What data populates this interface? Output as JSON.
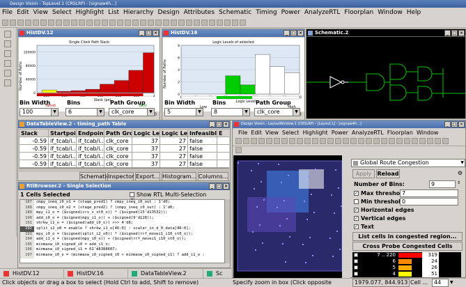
{
  "app": {
    "title": "Design Vision - TopLevel.1 (CRSLRP) - [signaw4h...]"
  },
  "menu": [
    "File",
    "Edit",
    "View",
    "Select",
    "Highlight",
    "List",
    "Hierarchy",
    "Design",
    "Attributes",
    "Schematic",
    "Timing",
    "Power",
    "AnalyzeRTL",
    "Floorplan",
    "Window",
    "Help"
  ],
  "hist1": {
    "title": "HistDV.12",
    "chart_title": "Single Clock Path Slack",
    "ylabel": "Number of Paths",
    "xlabel": "Slack (ps)",
    "worst": "Worst",
    "best": "Best",
    "count": "590",
    "count2": "0",
    "yticks": [
      "120000",
      "80000",
      "40000",
      "0"
    ],
    "xticks": [
      "-600",
      "-500",
      "-400",
      "-300",
      "-200",
      "-100",
      "0"
    ],
    "chart_data": {
      "type": "bar",
      "title": "Single Clock Path Slack",
      "xlabel": "Slack (ps)",
      "ylabel": "Number of Paths",
      "ylim": [
        0,
        140000
      ],
      "bins": [
        {
          "x0": -620,
          "x1": -540,
          "value": 8000,
          "color": "#ffff00"
        },
        {
          "x0": -540,
          "x1": -460,
          "value": 4000,
          "color": "#cc0000"
        },
        {
          "x0": -460,
          "x1": -380,
          "value": 6000,
          "color": "#cc0000"
        },
        {
          "x0": -380,
          "x1": -300,
          "value": 10000,
          "color": "#cc0000"
        },
        {
          "x0": -300,
          "x1": -220,
          "value": 25000,
          "color": "#cc0000"
        },
        {
          "x0": -220,
          "x1": -140,
          "value": 36000,
          "color": "#cc0000"
        },
        {
          "x0": -140,
          "x1": -60,
          "value": 66000,
          "color": "#cc0000"
        },
        {
          "x0": -60,
          "x1": 0,
          "value": 118000,
          "color": "#cc0000"
        }
      ]
    }
  },
  "hist2": {
    "title": "HistDV.16",
    "chart_title": "Logic Levels of selected",
    "ylabel": "Number of Paths",
    "xlabel": "Logic Levels",
    "low": "Low",
    "high": "High",
    "count": "0",
    "count2": "3",
    "yticks": [
      "8",
      "6",
      "4",
      "2",
      "0"
    ],
    "xticks": [
      "0",
      "5",
      "10",
      "15",
      "20",
      "25",
      "30",
      "35",
      "40"
    ],
    "chart_data": {
      "type": "bar",
      "title": "Logic Levels of selected",
      "xlabel": "Logic Levels",
      "ylabel": "Number of Paths",
      "ylim": [
        0,
        8
      ],
      "bins": [
        {
          "x0": 15,
          "x1": 20,
          "value": 3,
          "color": "#00cc00"
        },
        {
          "x0": 20,
          "x1": 25,
          "value": 1.5,
          "color": "#00cc00"
        },
        {
          "x0": 25,
          "x1": 30,
          "value": 6.5,
          "color": "#ffffff"
        },
        {
          "x0": 30,
          "x1": 35,
          "value": 4.5,
          "color": "#ffffff"
        },
        {
          "x0": 35,
          "x1": 40,
          "value": 3.5,
          "color": "#ffffff"
        }
      ]
    }
  },
  "controls1": {
    "bin_width_label": "Bin Width",
    "bins_label": "Bins",
    "path_group_label": "Path Group",
    "bin_width": "100",
    "bins": "6",
    "path_group": "clk_core"
  },
  "controls2": {
    "bin_width_label": "Bin Width",
    "bins_label": "Bins",
    "path_group_label": "Path Group",
    "bin_width": "5",
    "bins": "8",
    "path_group": "clk_core"
  },
  "schematic": {
    "title": "Schematic.2"
  },
  "datatable": {
    "title": "DataTableView.2 - timing_path Table",
    "columns": [
      "Slack",
      "Startpoint",
      "Endpoint",
      "Path Grou",
      "Logic Leve",
      "Logic Leve",
      "Infeasible",
      "E"
    ],
    "rows": [
      [
        "-0.59",
        "if_tcab/i...",
        "if_tcab/i...",
        "clk_core",
        "37",
        "27",
        "false",
        ""
      ],
      [
        "-0.59",
        "if_tcab/i...",
        "if_tcab/i...",
        "clk_core",
        "37",
        "27",
        "false",
        ""
      ],
      [
        "-0.59",
        "if_tcab/i...",
        "if_tcab/i...",
        "clk_core",
        "37",
        "27",
        "false",
        ""
      ],
      [
        "-0.59",
        "if_tcab/i...",
        "if_tcab/i...",
        "clk_core",
        "37",
        "27",
        "false",
        ""
      ]
    ],
    "buttons": [
      "Schematic",
      "Inspector",
      "Export...",
      "Histogram...",
      "Columns..."
    ]
  },
  "rtl": {
    "title": "RtlBrowser.2 - Single Selection",
    "cells_selected": "1 Cells Selected",
    "show_rtl": "Show RTL Multi-Selection Chooser",
    "lines": [
      [
        "187",
        "cmpy_ineq_i0_o1 = (stage_pred1) ? cmpy_ineq_i0_out : 1'd0;"
      ],
      [
        "188",
        "cmpy_ineq_i0_o2 = (stage_pred2) ? (cmpy_ineq_i0_out) : 1'd0;"
      ],
      [
        "189",
        "mpy_i1_o = ($signed(crv_x_st0_o)) * ($signed(15'd13532));"
      ],
      [
        "190",
        "add_i0_o = ($signed(mpy_i1_o)) + ($signed(9'd128));"
      ],
      [
        "191",
        "shrkw_i1_o = ($signed(add_i0_o)) >>> 4'd8;"
      ],
      [
        "192",
        "split_i2_o0 = enable ? shrkw_i1_o[46:0] : scaler_in_d_0_data[46:0];"
      ],
      [
        "193",
        "mpy_i0_o = ($signed(split_i2_o0)) * ($signed(rrf_movei1_i10_st0_o));"
      ],
      [
        "194",
        "add_i1_o = ($signed(mpy_i0_o)) + ($signed(rrf_movei1_i10_st0_o));"
      ],
      [
        "195",
        "minmaxw_i0_signed_i0 = add_i1_o;"
      ],
      [
        "196",
        "minmaxw_i0_signed_i1 = 61'd8388607;"
      ],
      [
        "197",
        "minmaxw_i0_o = (minmaxw_i0_signed_i0 < minmaxw_i0_signed_i1) ? add_i1_o :"
      ]
    ],
    "selected_line": "192"
  },
  "layout": {
    "title": "Design Vision - LayoutWindow.1 (CRSLRP) - [Layout.1] - [signaw4h...]",
    "menu": [
      "File",
      "Edit",
      "View",
      "Select",
      "Highlight",
      "Power",
      "AnalyzeRTL",
      "Floorplan",
      "Window"
    ]
  },
  "congestion": {
    "title": "Global Route Congestion",
    "apply": "Apply",
    "reload": "Reload",
    "num_bins_label": "Number of Bins:",
    "num_bins": "9",
    "max_label": "Max threshold:",
    "max": "7",
    "min_label": "Min threshold:",
    "min": "0",
    "horiz": "Horizontal edges",
    "vert": "Vertical edges",
    "text": "Text",
    "list_btn": "List cells in congested region...",
    "cross_btn": "Cross Probe Congested Cells",
    "bins": [
      {
        "range": "7 .. 220",
        "count": "319",
        "color": "#ff0000",
        "fill": 1.0
      },
      {
        "range": "6",
        "count": "24",
        "color": "#ff8800",
        "fill": 0.55
      },
      {
        "range": "5",
        "count": "26",
        "color": "#ffaa00",
        "fill": 0.55
      },
      {
        "range": "4",
        "count": "51",
        "color": "#ffff00",
        "fill": 0.55
      }
    ]
  },
  "taskbar": [
    "HistDV.12",
    "HistDV.16",
    "DataTableView.2",
    "Sc"
  ],
  "status": {
    "left": "Click objects or drag a box to select (Hold Ctrl to add, Shift to remove)",
    "mid": "Specify zoom in box (Click opposite",
    "coords": "1979.077, 844.913",
    "cell": "Cell ...",
    "zoom": "44"
  },
  "colors": {
    "title_blue": "#4a6fae",
    "histogram_red": "#cc0000",
    "histogram_green": "#00cc00",
    "schematic_bg": "#000000",
    "schematic_green": "#00c800"
  }
}
